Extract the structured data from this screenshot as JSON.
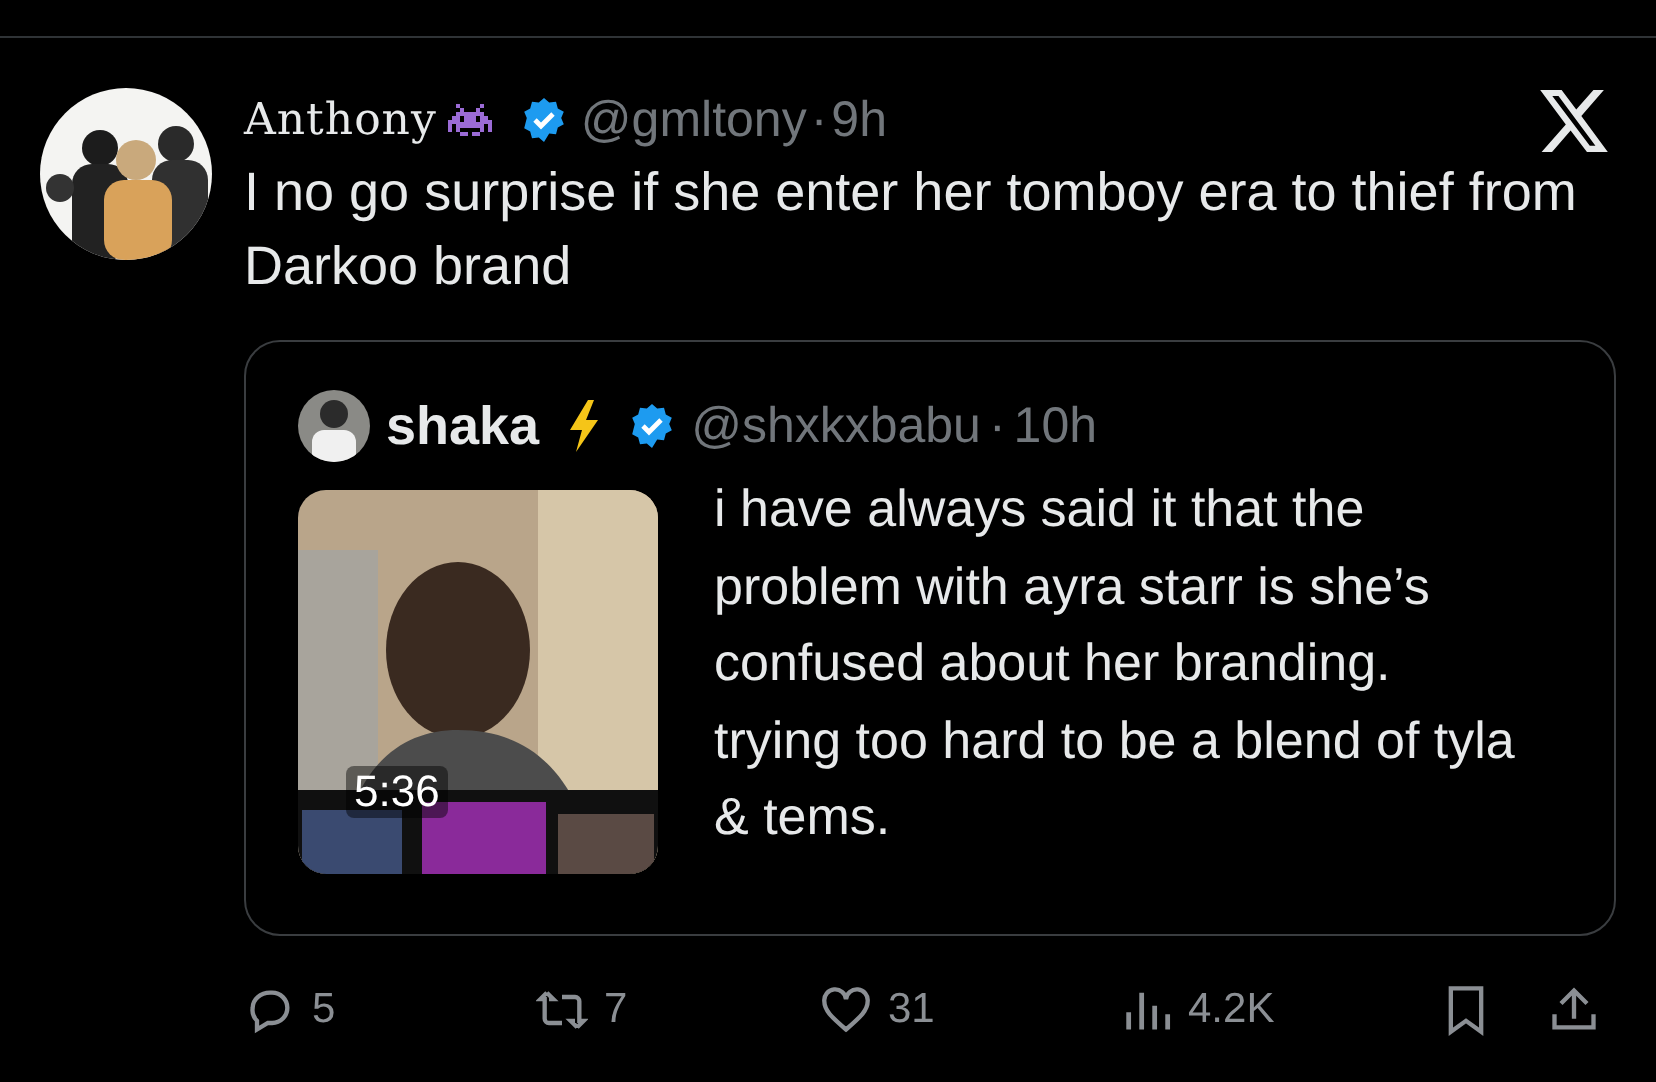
{
  "tweet": {
    "author": {
      "name": "Anthony",
      "handle": "@gmltony",
      "dot": "·",
      "time": "9h",
      "verified": true
    },
    "text": "I no go surprise if she enter her tomboy era to thief from Darkoo brand",
    "quote": {
      "author": {
        "name": "shaka",
        "handle": "@shxkxbabu",
        "dot": "·",
        "time": "10h",
        "verified": true
      },
      "media": {
        "kind": "picture",
        "duration": "5:36"
      },
      "text": "i have always said it that the problem with ayra starr is she’s confused about her branding. trying too hard to be a blend of tyla & tems."
    },
    "actions": [
      {
        "kind": "reply",
        "count": "5"
      },
      {
        "kind": "repost",
        "count": "7"
      },
      {
        "kind": "like",
        "count": "31"
      },
      {
        "kind": "views",
        "count": "4.2K"
      },
      {
        "kind": "bookmark"
      },
      {
        "kind": "share"
      }
    ]
  }
}
